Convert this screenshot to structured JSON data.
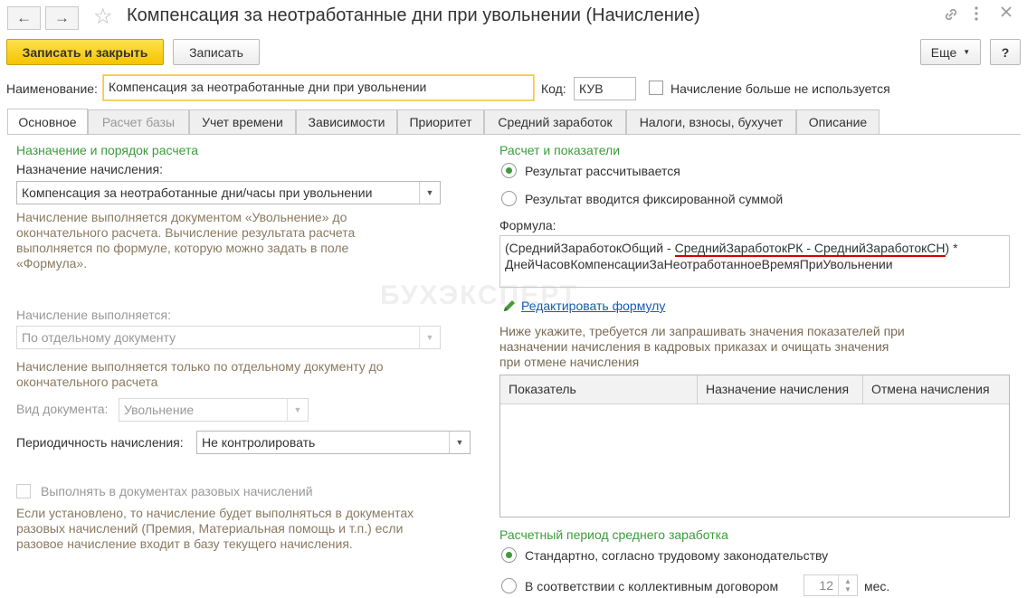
{
  "window": {
    "title": "Компенсация за неотработанные дни при увольнении (Начисление)",
    "back_icon": "←",
    "forward_icon": "→"
  },
  "toolbar": {
    "save_close_label": "Записать и закрыть",
    "save_label": "Записать",
    "more_label": "Еще",
    "help_label": "?"
  },
  "header": {
    "name_label": "Наименование:",
    "name_value": "Компенсация за неотработанные дни при увольнении",
    "code_label": "Код:",
    "code_value": "КУВ",
    "not_used_label": "Начисление больше не используется"
  },
  "tabs": [
    {
      "label": "Основное"
    },
    {
      "label": "Расчет базы"
    },
    {
      "label": "Учет времени"
    },
    {
      "label": "Зависимости"
    },
    {
      "label": "Приоритет"
    },
    {
      "label": "Средний заработок"
    },
    {
      "label": "Налоги, взносы, бухучет"
    },
    {
      "label": "Описание"
    }
  ],
  "left": {
    "section_title": "Назначение и порядок расчета",
    "purpose_label": "Назначение начисления:",
    "purpose_value": "Компенсация за неотработанные дни/часы при увольнении",
    "purpose_hint": "Начисление выполняется документом «Увольнение» до окончательного расчета. Вычисление результата расчета выполняется по формуле, которую можно задать в поле «Формула».",
    "performed_label": "Начисление выполняется:",
    "performed_value": "По отдельному документу",
    "performed_hint": "Начисление выполняется только по отдельному документу до окончательного расчета",
    "doc_type_label": "Вид документа:",
    "doc_type_value": "Увольнение",
    "periodicity_label": "Периодичность начисления:",
    "periodicity_value": "Не контролировать",
    "onetime_label": "Выполнять в документах разовых начислений",
    "onetime_hint": "Если установлено, то начисление будет выполняться в документах разовых начислений (Премия, Материальная помощь и т.п.) если разовое начисление входит в базу текущего начисления."
  },
  "right": {
    "section_title": "Расчет и показатели",
    "radio_calc": "Результат рассчитывается",
    "radio_fixed": "Результат вводится фиксированной суммой",
    "formula_label": "Формула:",
    "formula_part1": "(СреднийЗаработокОбщий - ",
    "formula_part2": "СреднийЗаработокРК - СреднийЗаработокСН",
    "formula_part3": ") * ДнейЧасовКомпенсацииЗаНеотработанноеВремяПриУвольнении",
    "edit_formula_link": "Редактировать формулу",
    "indicators_hint": "Ниже укажите, требуется ли запрашивать значения показателей при назначении начисления в кадровых приказах и очищать значения при отмене начисления",
    "table_columns": [
      "Показатель",
      "Назначение начисления",
      "Отмена начисления"
    ],
    "period_title": "Расчетный период среднего заработка",
    "radio_standard": "Стандартно, согласно трудовому законодательству",
    "radio_collective": "В соответствии с коллективным договором",
    "months_value": "12",
    "months_unit": "мес."
  },
  "watermark": "БУХЭКСПЕРТ"
}
